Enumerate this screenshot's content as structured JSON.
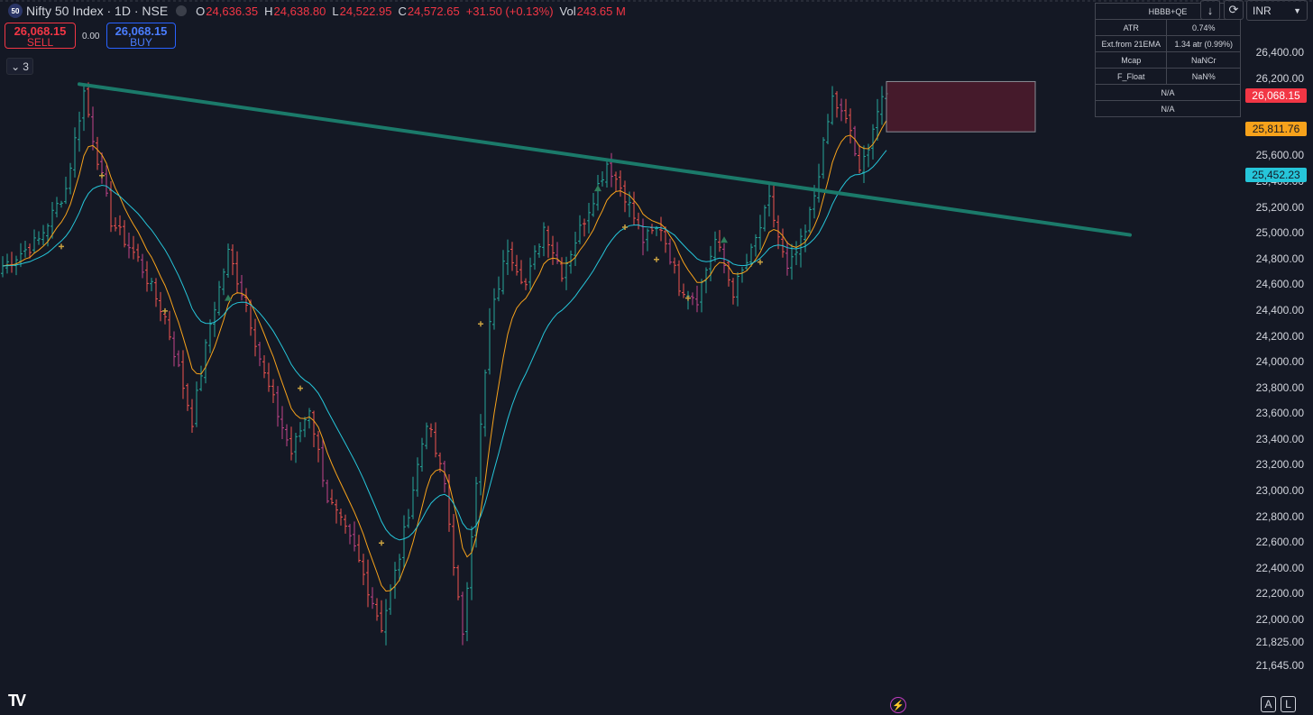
{
  "header": {
    "symbol_badge": "50",
    "title": "Nifty 50 Index · 1D · NSE",
    "open_key": "O",
    "open": "24,636.35",
    "high_key": "H",
    "high": "24,638.80",
    "low_key": "L",
    "low": "24,522.95",
    "close_key": "C",
    "close": "24,572.65",
    "change": "+31.50 (+0.13%)",
    "vol_key": "Vol",
    "vol": "243.65 M"
  },
  "trade": {
    "sell_price": "26,068.15",
    "sell_label": "SELL",
    "spread": "0.00",
    "buy_price": "26,068.15",
    "buy_label": "BUY"
  },
  "indicators_collapse": {
    "count": "3",
    "icon": "chevron-down-icon"
  },
  "info_table": {
    "title": "HBBB+QE",
    "rows": [
      {
        "label": "ATR",
        "value": "0.74%"
      },
      {
        "label": "Ext.from 21EMA",
        "value": "1.34 atr (0.99%)"
      },
      {
        "label": "Mcap",
        "value": "NaNCr"
      },
      {
        "label": "F_Float",
        "value": "NaN%"
      }
    ],
    "footer1": "N/A",
    "footer2": "N/A"
  },
  "toolbar": {
    "down_icon": "arrow-down-icon",
    "refresh_icon": "refresh-icon",
    "currency": "INR"
  },
  "price_labels": {
    "last": "26,068.15",
    "last_color": "#f23645",
    "ema_fast": "25,811.76",
    "ema_fast_color": "#f7a21b",
    "ema_slow": "25,452.23",
    "ema_slow_color": "#26c6da"
  },
  "y_ticks": [
    "26,400.00",
    "26,200.00",
    "25,600.00",
    "25,400.00",
    "25,200.00",
    "25,000.00",
    "24,800.00",
    "24,600.00",
    "24,400.00",
    "24,200.00",
    "24,000.00",
    "23,800.00",
    "23,600.00",
    "23,400.00",
    "23,200.00",
    "23,000.00",
    "22,800.00",
    "22,600.00",
    "22,400.00",
    "22,200.00",
    "22,000.00",
    "21,825.00",
    "21,645.00"
  ],
  "bottom": {
    "logo": "TV",
    "flash_icon": "lightning-icon",
    "auto_label": "A",
    "log_label": "L"
  },
  "chart_data": {
    "type": "candlestick",
    "ylim": [
      21645,
      26400
    ],
    "colors": {
      "bull": "#26a69a",
      "bear": "#ef5350",
      "ema_fast": "#f7a21b",
      "ema_slow": "#26c6da",
      "trendline": "#1b7a6a"
    },
    "anchors": [
      [
        0,
        24750
      ],
      [
        8,
        24950
      ],
      [
        14,
        25350
      ],
      [
        18,
        26100
      ],
      [
        20,
        25750
      ],
      [
        24,
        25100
      ],
      [
        30,
        24800
      ],
      [
        36,
        24350
      ],
      [
        42,
        23550
      ],
      [
        46,
        24300
      ],
      [
        50,
        24850
      ],
      [
        54,
        24450
      ],
      [
        58,
        23900
      ],
      [
        64,
        23300
      ],
      [
        68,
        23650
      ],
      [
        72,
        22950
      ],
      [
        78,
        22550
      ],
      [
        84,
        21950
      ],
      [
        88,
        22500
      ],
      [
        94,
        23550
      ],
      [
        98,
        23050
      ],
      [
        100,
        22450
      ],
      [
        102,
        21850
      ],
      [
        104,
        22700
      ],
      [
        108,
        24300
      ],
      [
        112,
        24900
      ],
      [
        116,
        24600
      ],
      [
        120,
        25050
      ],
      [
        124,
        24700
      ],
      [
        130,
        25200
      ],
      [
        134,
        25550
      ],
      [
        138,
        25300
      ],
      [
        142,
        24950
      ],
      [
        146,
        25050
      ],
      [
        150,
        24600
      ],
      [
        154,
        24500
      ],
      [
        158,
        24950
      ],
      [
        162,
        24550
      ],
      [
        166,
        24850
      ],
      [
        170,
        25250
      ],
      [
        174,
        24700
      ],
      [
        178,
        25000
      ],
      [
        180,
        25300
      ],
      [
        184,
        26050
      ],
      [
        188,
        25800
      ],
      [
        190,
        25450
      ],
      [
        194,
        25950
      ],
      [
        196,
        26068
      ]
    ],
    "trendline": {
      "x": [
        17,
        250
      ],
      "y": [
        26160,
        24990
      ]
    },
    "target_zone": {
      "x": [
        196,
        229
      ],
      "y": [
        26180,
        25790
      ]
    }
  }
}
